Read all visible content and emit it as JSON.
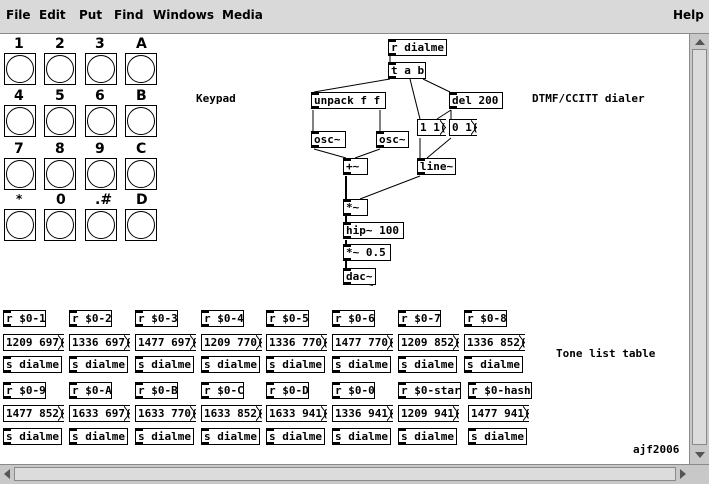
{
  "menu": {
    "file": "File",
    "edit": "Edit",
    "put": "Put",
    "find": "Find",
    "windows": "Windows",
    "media": "Media",
    "help": "Help"
  },
  "keypad": {
    "title": "Keypad",
    "keys": [
      "1",
      "2",
      "3",
      "A",
      "4",
      "5",
      "6",
      "B",
      "7",
      "8",
      "9",
      "C",
      "*",
      "0",
      ".#",
      "D"
    ]
  },
  "dialer": {
    "title": "DTMF/CCITT dialer",
    "r_dialme": "r dialme",
    "t_ab": "t a b",
    "unpack": "unpack f f",
    "del": "del 200",
    "osc1": "osc~",
    "osc2": "osc~",
    "msg_11": "1 1(",
    "msg_01": "0 1(",
    "plus": "+~",
    "line": "line~",
    "times": "*~",
    "hip": "hip~ 100",
    "times05": "*~ 0.5",
    "dac": "dac~"
  },
  "tones": {
    "title": "Tone list table",
    "row1": [
      {
        "recv": "r $0-1",
        "msg": "1209 697(",
        "send": "s dialme"
      },
      {
        "recv": "r $0-2",
        "msg": "1336 697(",
        "send": "s dialme"
      },
      {
        "recv": "r $0-3",
        "msg": "1477 697(",
        "send": "s dialme"
      },
      {
        "recv": "r $0-4",
        "msg": "1209 770(",
        "send": "s dialme"
      },
      {
        "recv": "r $0-5",
        "msg": "1336 770(",
        "send": "s dialme"
      },
      {
        "recv": "r $0-6",
        "msg": "1477 770(",
        "send": "s dialme"
      },
      {
        "recv": "r $0-7",
        "msg": "1209 852(",
        "send": "s dialme"
      },
      {
        "recv": "r $0-8",
        "msg": "1336 852(",
        "send": "s dialme"
      }
    ],
    "row2": [
      {
        "recv": "r $0-9",
        "msg": "1477 852(",
        "send": "s dialme"
      },
      {
        "recv": "r $0-A",
        "msg": "1633 697(",
        "send": "s dialme"
      },
      {
        "recv": "r $0-B",
        "msg": "1633 770(",
        "send": "s dialme"
      },
      {
        "recv": "r $0-C",
        "msg": "1633 852(",
        "send": "s dialme"
      },
      {
        "recv": "r $0-D",
        "msg": "1633 941(",
        "send": "s dialme"
      },
      {
        "recv": "r $0-0",
        "msg": "1336 941(",
        "send": "s dialme"
      },
      {
        "recv": "r $0-star",
        "msg": "1209 941(",
        "send": "s dialme"
      },
      {
        "recv": "r $0-hash",
        "msg": "1477 941(",
        "send": "s dialme"
      }
    ]
  },
  "credit": "ajf2006"
}
